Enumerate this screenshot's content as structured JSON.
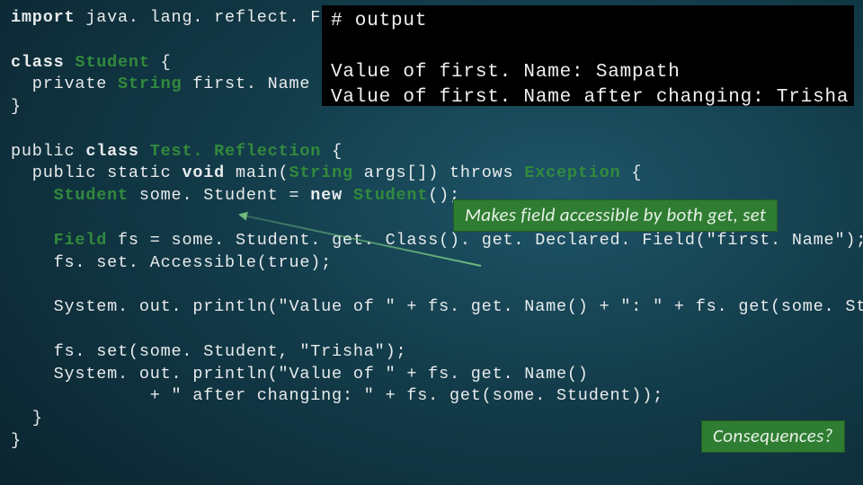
{
  "code": {
    "l1_kw": "import",
    "l1_rest": " java. lang. reflect. Field;",
    "l3_kw": "class",
    "l3_cls": " Student",
    "l3_rest": " {",
    "l4_pre": "  private ",
    "l4_cls": "String",
    "l4_rest": " first. Name = \"S",
    "l5": "}",
    "l7_pre": "public ",
    "l7_kw": "class",
    "l7_cls": " Test. Reflection",
    "l7_rest": " {",
    "l8_pre": "  public static ",
    "l8_kw": "void",
    "l8_mid": " main(",
    "l8_cls": "String",
    "l8_rest": " args[]) throws ",
    "l8_exc": "Exception",
    "l8_end": " {",
    "l9_pre": "    ",
    "l9_cls": "Student",
    "l9_mid": " some. Student = ",
    "l9_kw": "new",
    "l9_cls2": " Student",
    "l9_end": "();",
    "l11_pre": "    ",
    "l11_cls": "Field",
    "l11_rest": " fs = some. Student. get. Class(). get. Declared. Field(\"first. Name\");",
    "l12": "    fs. set. Accessible(true);",
    "l14": "    System. out. println(\"Value of \" + fs. get. Name() + \": \" + fs. get(some. Student));",
    "l16": "    fs. set(some. Student, \"Trisha\");",
    "l17": "    System. out. println(\"Value of \" + fs. get. Name()",
    "l18": "             + \" after changing: \" + fs. get(some. Student));",
    "l19": "  }",
    "l20": "}"
  },
  "output": {
    "header": "# output",
    "line1": "Value of first. Name: Sampath",
    "line2": "Value of first. Name after changing: Trisha"
  },
  "callouts": {
    "accessible": "Makes field accessible by both get, set",
    "consequences": "Consequences?"
  }
}
